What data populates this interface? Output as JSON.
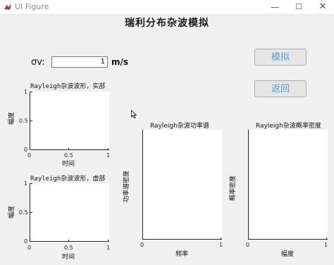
{
  "window": {
    "title": "UI Figure"
  },
  "figure_title": "瑞利分布杂波模拟",
  "sigma": {
    "label": "σv:",
    "value": "1",
    "unit": "m/s"
  },
  "buttons": {
    "simulate": "模拟",
    "back": "返回"
  },
  "axes": {
    "real": {
      "title": "Rayleigh杂波波形，实部",
      "ylabel": "幅度",
      "xlabel": "时间",
      "xticks": [
        "0",
        "0.5",
        "1"
      ],
      "yticks": [
        "1",
        "0.5",
        "0"
      ]
    },
    "imag": {
      "title": "Rayleigh杂波波形，虚部",
      "ylabel": "幅度",
      "xlabel": "时间",
      "xticks": [
        "0",
        "0.5",
        "1"
      ],
      "yticks": [
        "1",
        "0.5",
        "0"
      ]
    },
    "psd": {
      "title": "Rayleigh杂波功率谱",
      "ylabel": "功率谱密度",
      "xlabel": "频率",
      "xticks": [
        "0",
        "1"
      ]
    },
    "pdf": {
      "title": "Rayleigh杂波概率密度",
      "ylabel": "概率密度",
      "xlabel": "幅度",
      "xticks": [
        "0",
        "1"
      ]
    }
  }
}
